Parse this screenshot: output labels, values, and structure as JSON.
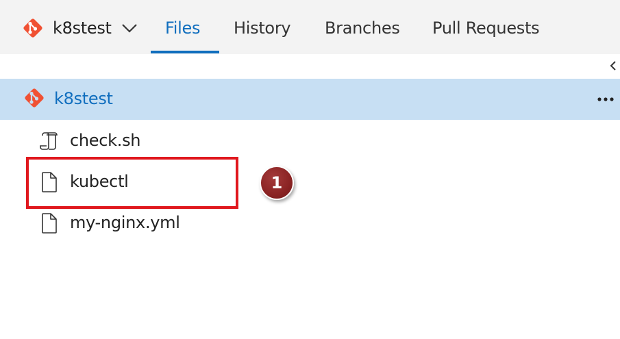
{
  "header": {
    "repo_name": "k8stest",
    "tabs": [
      {
        "label": "Files",
        "active": true
      },
      {
        "label": "History",
        "active": false
      },
      {
        "label": "Branches",
        "active": false
      },
      {
        "label": "Pull Requests",
        "active": false
      }
    ]
  },
  "tree": {
    "root_label": "k8stest",
    "files": [
      {
        "name": "check.sh",
        "icon": "script-icon"
      },
      {
        "name": "kubectl",
        "icon": "file-icon"
      },
      {
        "name": "my-nginx.yml",
        "icon": "file-icon"
      }
    ]
  },
  "annotation": {
    "step_number": "1"
  },
  "colors": {
    "accent": "#106ebe",
    "git_brand": "#f05133",
    "selected_row": "#c7dff3",
    "highlight_border": "#e0181e",
    "badge": "#8a2323"
  }
}
